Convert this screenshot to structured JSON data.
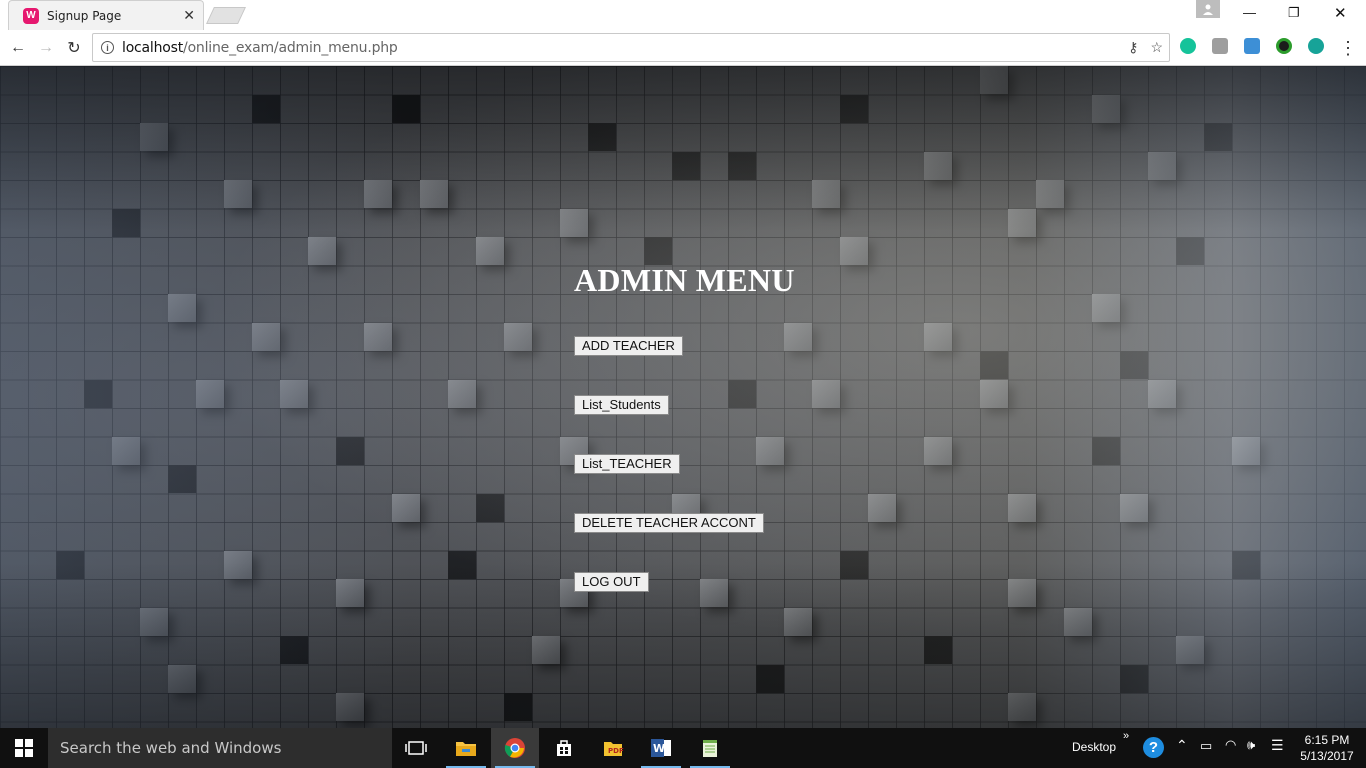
{
  "browser": {
    "tab_title": "Signup Page",
    "favicon_letter": "W",
    "url_host": "localhost",
    "url_path": "/online_exam/admin_menu.php"
  },
  "page": {
    "title": "ADMIN MENU",
    "buttons": [
      {
        "label": "ADD TEACHER"
      },
      {
        "label": "List_Students"
      },
      {
        "label": "List_TEACHER"
      },
      {
        "label": "DELETE TEACHER ACCONT"
      },
      {
        "label": "LOG OUT"
      }
    ]
  },
  "taskbar": {
    "search_placeholder": "Search the web and Windows",
    "desktop_label": "Desktop",
    "time": "6:15 PM",
    "date": "5/13/2017"
  },
  "colors": {
    "accent": "#76b9ed",
    "favicon": "#e6186f"
  }
}
